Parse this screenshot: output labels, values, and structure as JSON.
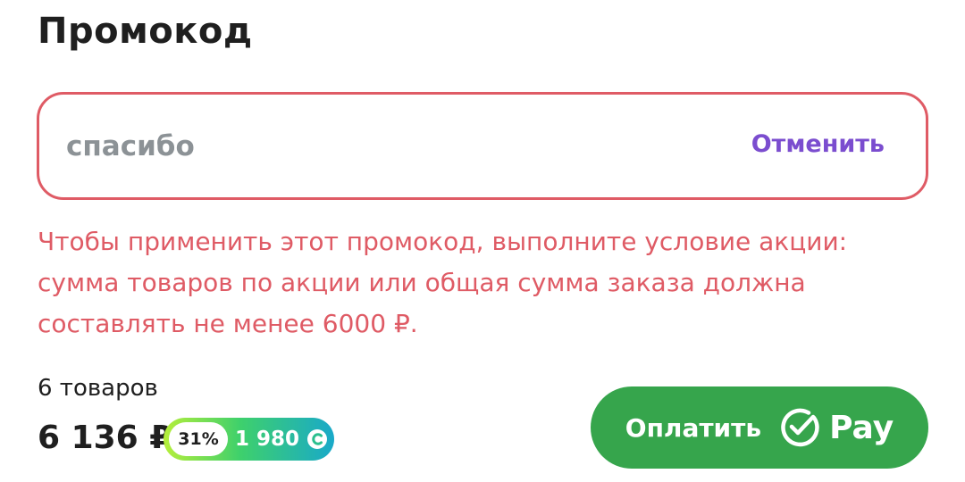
{
  "promo": {
    "title": "Промокод",
    "input_value": "спасибо",
    "cancel_label": "Отменить",
    "error_message": "Чтобы применить этот промокод, выполните условие акции: сумма товаров по акции или общая сумма заказа должна составлять не менее 6000 ₽."
  },
  "summary": {
    "items_count": "6 товаров",
    "total": "6 136 ₽",
    "bonus_percent": "31%",
    "bonus_amount": "1 980",
    "bonus_icon": "sber-spasibo-icon"
  },
  "pay_button": {
    "label": "Оплатить",
    "icon": "sber-check-icon",
    "brand": "Pay"
  },
  "colors": {
    "error": "#df5b65",
    "accent_purple": "#7b4dcf",
    "pay_green": "#36a54c"
  }
}
